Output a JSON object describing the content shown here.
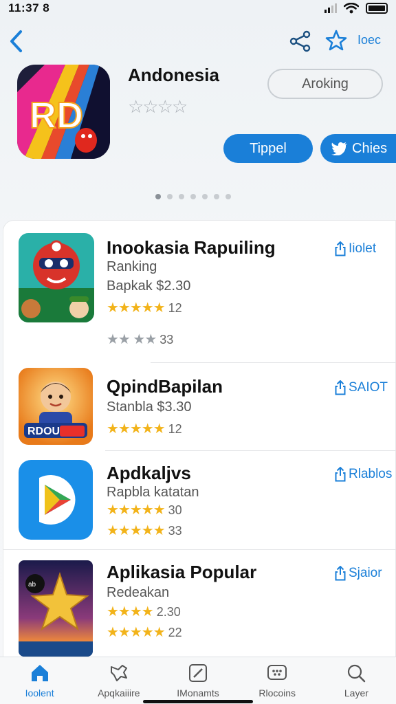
{
  "status_bar": {
    "time": "11:37 8"
  },
  "nav": {
    "top_link": "Ioec"
  },
  "hero": {
    "title": "Andonesia",
    "primary_button": "Aroking",
    "tippel_button": "Tippel",
    "chies_button": "Chies",
    "rating_stars": 4
  },
  "pager": {
    "count": 7,
    "active_index": 0
  },
  "apps": [
    {
      "name": "Inookasia Rapuiling",
      "subtitle": "Ranking",
      "price_line": "Bapkak $2.30",
      "rating1": {
        "stars": "★★★★★",
        "value": "12"
      },
      "rating2": {
        "stars": "★★ ★★",
        "value": "33"
      },
      "action": "Iiolet"
    },
    {
      "name": "QpindBapilan",
      "subtitle": "Stanbla $3.30",
      "rating1": {
        "stars": "★★★★★",
        "value": "12"
      },
      "action": "SAIOT"
    },
    {
      "name": "Apdkaljvs",
      "subtitle": "Rapbla katatan",
      "rating1": {
        "stars": "★★★★★",
        "value": "30"
      },
      "rating2": {
        "stars": "★★★★★",
        "value": "33"
      },
      "action": "Rlablos"
    },
    {
      "name": "Aplikasia Popular",
      "subtitle": "Redeakan",
      "rating1": {
        "stars": "★★★★",
        "value": "2.30"
      },
      "rating2": {
        "stars": "★★★★★",
        "value": "22"
      },
      "action": "Sjaior"
    }
  ],
  "tabs": [
    {
      "label": "Ioolent",
      "icon": "home-icon",
      "active": true
    },
    {
      "label": "Apqkaiiire",
      "icon": "controller-icon",
      "active": false
    },
    {
      "label": "IMonamts",
      "icon": "edit-icon",
      "active": false
    },
    {
      "label": "Rlocoins",
      "icon": "chat-icon",
      "active": false
    },
    {
      "label": "Layer",
      "icon": "search-icon",
      "active": false
    }
  ],
  "colors": {
    "accent": "#1a7fd8",
    "star": "#f2b31a"
  }
}
